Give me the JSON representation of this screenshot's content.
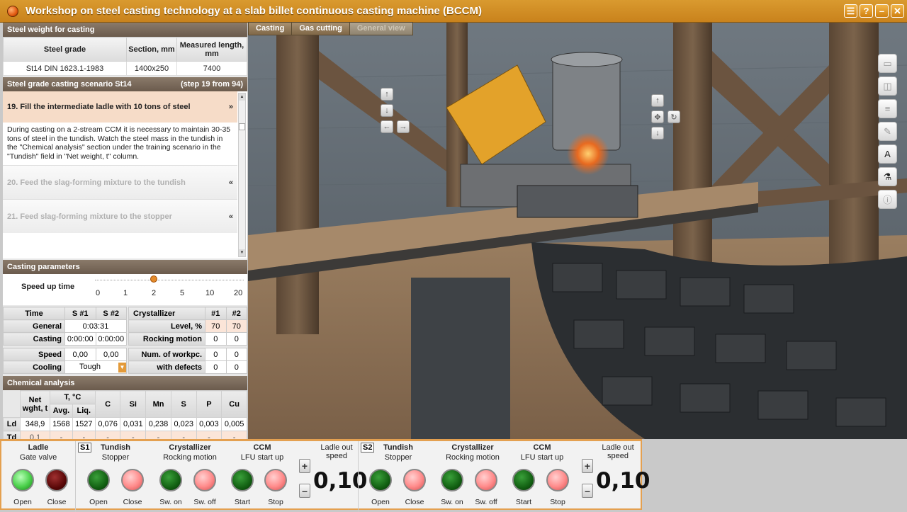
{
  "window": {
    "title": "Workshop on steel casting technology at a slab billet continuous casting machine (BCCM)",
    "buttons": [
      "☰",
      "?",
      "–",
      "✕"
    ]
  },
  "steel_weight": {
    "header": "Steel weight for casting",
    "columns": [
      "Steel grade",
      "Section, mm",
      "Measured length, mm"
    ],
    "row": [
      "St14 DIN 1623.1-1983",
      "1400x250",
      "7400"
    ]
  },
  "scenario": {
    "header": "Steel grade casting scenario St14",
    "step_info": "(step 19 from 94)",
    "active_step": "19. Fill the intermediate ladle with 10 tons of steel",
    "active_chevron": "»",
    "description": "During casting on a 2-stream CCM it is necessary to maintain 30-35 tons of steel in the tundish. Watch the steel mass in the tundish in the \"Chemical analysis\" section under the training scenario in the \"Tundish\" field in \"Net weight, t\" column.",
    "next_steps": [
      {
        "label": "20. Feed the slag-forming mixture to the tundish",
        "chevron": "«"
      },
      {
        "label": "21. Feed slag-forming mixture to the stopper",
        "chevron": "«"
      }
    ]
  },
  "casting_params": {
    "header": "Casting parameters",
    "speed_label": "Speed up time",
    "speed_ticks": [
      "0",
      "1",
      "2",
      "5",
      "10",
      "20"
    ],
    "speed_selected": "2",
    "time_header": [
      "Time",
      "S #1",
      "S #2"
    ],
    "general_label": "General",
    "general_value": "0:03:31",
    "casting_label": "Casting",
    "casting_s1": "0:00:00",
    "casting_s2": "0:00:00",
    "speed_row_label": "Speed",
    "speed_s1": "0,00",
    "speed_s2": "0,00",
    "cooling_label": "Cooling",
    "cooling_value": "Tough",
    "cryst_header": [
      "Crystallizer",
      "#1",
      "#2"
    ],
    "level_label": "Level, %",
    "level_1": "70",
    "level_2": "70",
    "rocking_label": "Rocking motion",
    "rocking_1": "0",
    "rocking_2": "0",
    "workpc_label": "Num. of workpc.",
    "workpc_1": "0",
    "workpc_2": "0",
    "defects_label": "with defects",
    "defects_1": "0",
    "defects_2": "0"
  },
  "chemical": {
    "header": "Chemical analysis",
    "net_label": "Net wght, t",
    "temp_label": "T, °C",
    "avg_label": "Avg.",
    "liq_label": "Liq.",
    "elements": [
      "C",
      "Si",
      "Mn",
      "S",
      "P",
      "Cu"
    ],
    "rows": [
      {
        "label": "Ld",
        "net": "348,9",
        "avg": "1568",
        "liq": "1527",
        "vals": [
          "0,076",
          "0,031",
          "0,238",
          "0,023",
          "0,003",
          "0,005"
        ]
      },
      {
        "label": "Td",
        "net": "0,1",
        "avg": "-",
        "liq": "-",
        "vals": [
          "-",
          "-",
          "-",
          "-",
          "-",
          "-"
        ]
      }
    ]
  },
  "view_tabs": [
    {
      "label": "Casting"
    },
    {
      "label": "Gas cutting"
    },
    {
      "label": "General view"
    }
  ],
  "controls": {
    "ladle": {
      "title": "Ladle",
      "sub": "Gate valve",
      "open": "Open",
      "close": "Close"
    },
    "streams": [
      {
        "badge": "S1",
        "tundish": "Tundish",
        "stopper": "Stopper",
        "cryst": "Crystallizer",
        "rocking": "Rocking motion",
        "ccm": "CCM",
        "lfu": "LFU start up",
        "speed_label": "Ladle out speed",
        "speed": "0,10",
        "open": "Open",
        "close": "Close",
        "swon": "Sw. on",
        "swoff": "Sw. off",
        "start": "Start",
        "stop": "Stop"
      },
      {
        "badge": "S2",
        "tundish": "Tundish",
        "stopper": "Stopper",
        "cryst": "Crystallizer",
        "rocking": "Rocking motion",
        "ccm": "CCM",
        "lfu": "LFU start up",
        "speed_label": "Ladle out speed",
        "speed": "0,10",
        "open": "Open",
        "close": "Close",
        "swon": "Sw. on",
        "swoff": "Sw. off",
        "start": "Start",
        "stop": "Stop"
      }
    ]
  }
}
